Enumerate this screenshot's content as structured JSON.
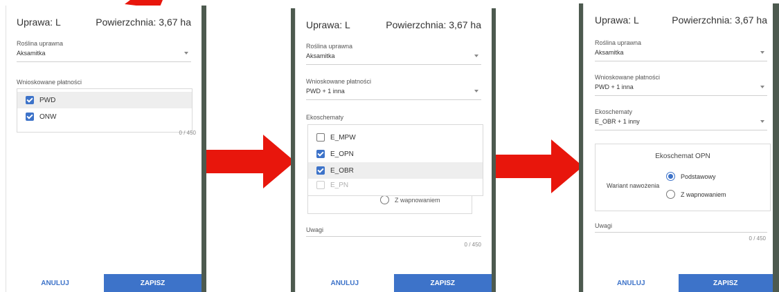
{
  "header_title": "Uprawa: L",
  "header_area": "Powierzchnia: 3,67 ha",
  "crop_label": "Roślina uprawna",
  "crop_value": "Aksamitka",
  "payments_label": "Wnioskowane płatności",
  "payments_value": "PWD + 1 inna",
  "payments_options": [
    "PWD",
    "ONW"
  ],
  "ecoschemes_label": "Ekoschematy",
  "ecoschemes_value": "E_OBR + 1 inny",
  "ecoschemes_options": [
    "E_MPW",
    "E_OPN",
    "E_OBR",
    "E_PN"
  ],
  "ecoscheme_box_title": "Ekoschemat OPN",
  "fert_label": "Wariant nawożenia",
  "fert_options": [
    "Podstawowy",
    "Z wapnowaniem"
  ],
  "fert_partial": "Z wapnowaniem",
  "notes_label": "Uwagi",
  "counter": "0 / 450",
  "counter_partial": "0 / 450",
  "cancel_label": "ANULUJ",
  "save_label": "ZAPISZ",
  "colors": {
    "accent": "#3d73c9",
    "arrow": "#e8160c"
  }
}
